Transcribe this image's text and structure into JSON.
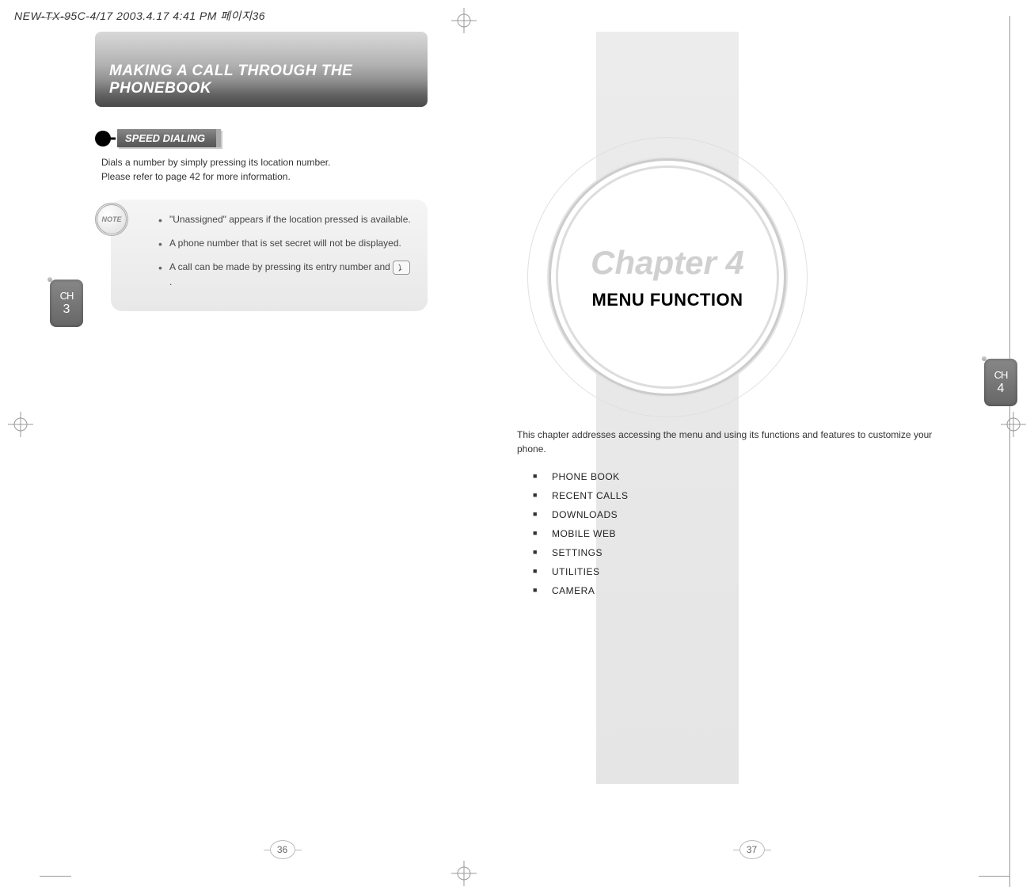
{
  "meta": {
    "header_text": "NEW-TX-95C-4/17  2003.4.17 4:41 PM  페이지36"
  },
  "left": {
    "banner_title": "MAKING A CALL THROUGH THE PHONEBOOK",
    "section_label": "SPEED DIALING",
    "section_desc_line1": "Dials a number by simply pressing its location number.",
    "section_desc_line2": "Please refer to page 42 for more information.",
    "note_badge": "NOTE",
    "notes": [
      "\"Unassigned\" appears if the location pressed is available.",
      "A phone number that is set secret will not be displayed.",
      "A call can be made by pressing its entry number and"
    ],
    "note3_tail": ".",
    "ch_letters": "CH",
    "ch_num": "3",
    "page_number": "36"
  },
  "right": {
    "chapter_title": "Chapter 4",
    "chapter_name": "MENU FUNCTION",
    "intro": "This chapter addresses accessing the menu and using its functions and features to customize your phone.",
    "items": [
      "PHONE BOOK",
      "RECENT CALLS",
      "DOWNLOADS",
      "MOBILE WEB",
      "SETTINGS",
      "UTILITIES",
      "CAMERA"
    ],
    "ch_letters": "CH",
    "ch_num": "4",
    "page_number": "37"
  }
}
